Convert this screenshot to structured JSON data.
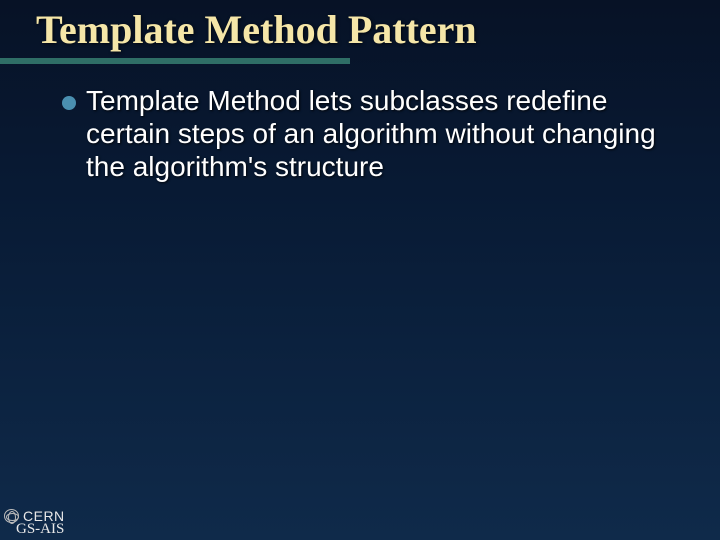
{
  "title": "Template Method Pattern",
  "bullets": [
    "Template Method lets subclasses redefine certain steps of an algorithm without changing the algorithm's structure"
  ],
  "footer": {
    "org": "CERN",
    "sub": "GS-AIS"
  }
}
